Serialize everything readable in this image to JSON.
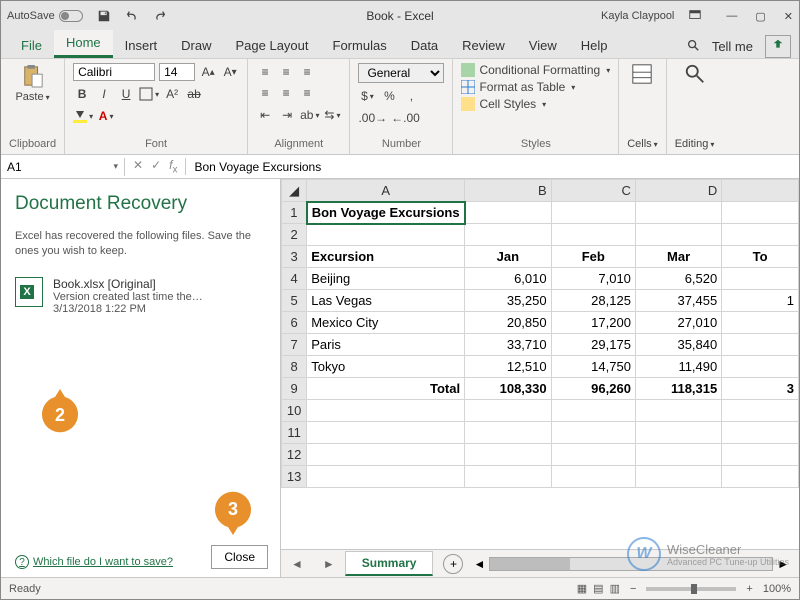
{
  "titlebar": {
    "autosave": "AutoSave",
    "title": "Book - Excel",
    "user": "Kayla Claypool"
  },
  "ribbon_tabs": [
    "File",
    "Home",
    "Insert",
    "Draw",
    "Page Layout",
    "Formulas",
    "Data",
    "Review",
    "View",
    "Help"
  ],
  "active_tab": "Home",
  "tell_me": "Tell me",
  "ribbon": {
    "clipboard": "Clipboard",
    "paste": "Paste",
    "font": "Font",
    "font_name": "Calibri",
    "font_size": "14",
    "alignment": "Alignment",
    "number": "Number",
    "number_format": "General",
    "styles": "Styles",
    "cond_fmt": "Conditional Formatting",
    "fmt_table": "Format as Table",
    "cell_styles": "Cell Styles",
    "cells": "Cells",
    "editing": "Editing"
  },
  "formula_bar": {
    "name_box": "A1",
    "formula": "Bon Voyage Excursions"
  },
  "recovery": {
    "title": "Document Recovery",
    "desc": "Excel has recovered the following files.  Save the ones you wish to keep.",
    "item_name": "Book.xlsx  [Original]",
    "item_meta": "Version created last time the…",
    "item_date": "3/13/2018 1:22 PM",
    "which_file": "Which file do I want to save?",
    "close": "Close"
  },
  "callouts": {
    "c2": "2",
    "c3": "3"
  },
  "grid": {
    "cols": [
      "A",
      "B",
      "C",
      "D"
    ],
    "extra_col": "To",
    "row1": "Bon Voyage Excursions",
    "hdr": [
      "Excursion",
      "Jan",
      "Feb",
      "Mar"
    ],
    "rows": [
      {
        "city": "Beijing",
        "vals": [
          "6,010",
          "7,010",
          "6,520"
        ],
        "extra": ""
      },
      {
        "city": "Las Vegas",
        "vals": [
          "35,250",
          "28,125",
          "37,455"
        ],
        "extra": "1"
      },
      {
        "city": "Mexico City",
        "vals": [
          "20,850",
          "17,200",
          "27,010"
        ],
        "extra": ""
      },
      {
        "city": "Paris",
        "vals": [
          "33,710",
          "29,175",
          "35,840"
        ],
        "extra": ""
      },
      {
        "city": "Tokyo",
        "vals": [
          "12,510",
          "14,750",
          "11,490"
        ],
        "extra": ""
      }
    ],
    "total_label": "Total",
    "total": [
      "108,330",
      "96,260",
      "118,315"
    ],
    "total_extra": "3"
  },
  "sheet_tab": "Summary",
  "statusbar": {
    "ready": "Ready",
    "zoom": "100%"
  },
  "watermark": {
    "name": "WiseCleaner",
    "sub": "Advanced PC Tune-up Utilities"
  }
}
